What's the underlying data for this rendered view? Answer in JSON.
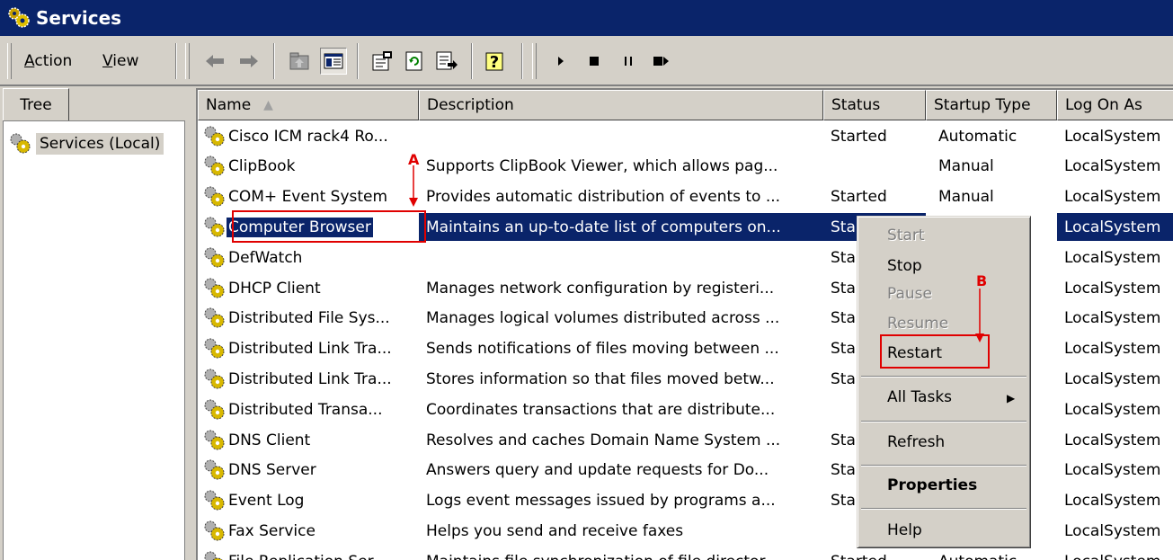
{
  "window": {
    "title": "Services",
    "icon": "services-gear-icon"
  },
  "menu": [
    {
      "label": "Action",
      "underline": "A",
      "rest": "ction"
    },
    {
      "label": "View",
      "underline": "V",
      "rest": "iew"
    }
  ],
  "toolbar": {
    "icons": [
      "back-arrow-icon",
      "forward-arrow-icon",
      "up-folder-icon",
      "show-hide-tree-icon",
      "properties-icon",
      "refresh-icon",
      "export-list-icon",
      "help-icon",
      "start-service-icon",
      "stop-service-icon",
      "pause-service-icon",
      "restart-service-icon"
    ]
  },
  "tree": {
    "tab_label": "Tree",
    "root_label": "Services (Local)"
  },
  "list": {
    "columns": [
      "Name",
      "Description",
      "Status",
      "Startup Type",
      "Log On As"
    ],
    "sort_indicator": "▲",
    "rows": [
      {
        "name": "Cisco ICM rack4 Ro...",
        "description": "",
        "status": "Started",
        "startup": "Automatic",
        "logon": "LocalSystem"
      },
      {
        "name": "ClipBook",
        "description": "Supports ClipBook Viewer, which allows pag...",
        "status": "",
        "startup": "Manual",
        "logon": "LocalSystem"
      },
      {
        "name": "COM+ Event System",
        "description": "Provides automatic distribution of events to ...",
        "status": "Started",
        "startup": "Manual",
        "logon": "LocalSystem"
      },
      {
        "name": "Computer Browser",
        "description": "Maintains an up-to-date list of computers on...",
        "status": "Sta",
        "startup": "",
        "logon": "LocalSystem",
        "selected": true
      },
      {
        "name": "DefWatch",
        "description": "",
        "status": "Sta",
        "startup": "",
        "logon": "LocalSystem"
      },
      {
        "name": "DHCP Client",
        "description": "Manages network configuration by registeri...",
        "status": "Sta",
        "startup": "",
        "logon": "LocalSystem"
      },
      {
        "name": "Distributed File Sys...",
        "description": "Manages logical volumes distributed across ...",
        "status": "Sta",
        "startup": "",
        "logon": "LocalSystem"
      },
      {
        "name": "Distributed Link Tra...",
        "description": "Sends notifications of files moving between ...",
        "status": "Sta",
        "startup": "",
        "logon": "LocalSystem"
      },
      {
        "name": "Distributed Link Tra...",
        "description": "Stores information so that files moved betw...",
        "status": "Sta",
        "startup": "",
        "logon": "LocalSystem"
      },
      {
        "name": "Distributed Transa...",
        "description": "Coordinates transactions that are distribute...",
        "status": "",
        "startup": "",
        "logon": "LocalSystem"
      },
      {
        "name": "DNS Client",
        "description": "Resolves and caches Domain Name System ...",
        "status": "Sta",
        "startup": "",
        "logon": "LocalSystem"
      },
      {
        "name": "DNS Server",
        "description": "Answers query and update requests for Do...",
        "status": "Sta",
        "startup": "",
        "logon": "LocalSystem"
      },
      {
        "name": "Event Log",
        "description": "Logs event messages issued by programs a...",
        "status": "Sta",
        "startup": "",
        "logon": "LocalSystem"
      },
      {
        "name": "Fax Service",
        "description": "Helps you send and receive faxes",
        "status": "",
        "startup": "",
        "logon": "LocalSystem"
      },
      {
        "name": "File Replication Ser...",
        "description": "Maintains file synchronization of file director...",
        "status": "Started",
        "startup": "Automatic",
        "logon": "LocalSystem"
      }
    ]
  },
  "context_menu": {
    "items": [
      {
        "label": "Start",
        "disabled": true
      },
      {
        "label": "Stop",
        "disabled": false
      },
      {
        "label": "Pause",
        "disabled": true
      },
      {
        "label": "Resume",
        "disabled": true
      },
      {
        "label": "Restart",
        "disabled": false
      },
      {
        "label": "All Tasks",
        "disabled": false,
        "submenu": true
      },
      {
        "label": "Refresh",
        "disabled": false
      },
      {
        "label": "Properties",
        "disabled": false,
        "bold": true
      },
      {
        "label": "Help",
        "disabled": false
      }
    ],
    "submenu_arrow": "▶"
  },
  "annotations": {
    "a_label": "A",
    "b_label": "B",
    "color": "#e00000"
  },
  "colors": {
    "titlebar": "#0a246a",
    "selection": "#0a246a",
    "face": "#d4d0c8"
  }
}
